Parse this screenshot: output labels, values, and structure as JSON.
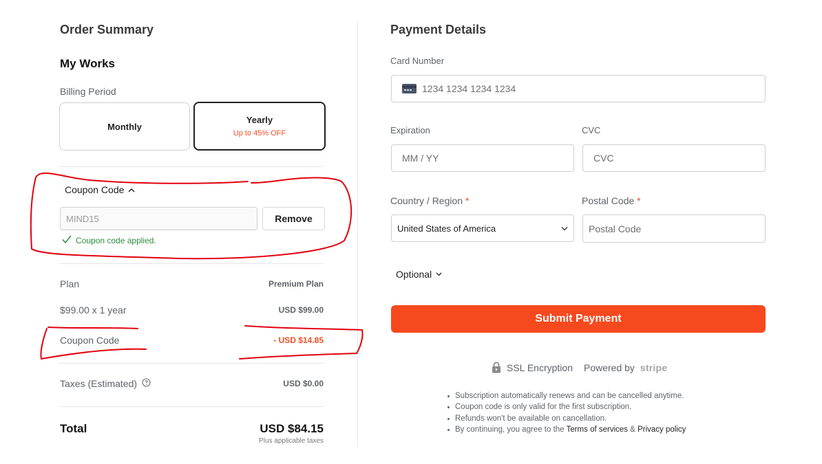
{
  "order_summary": {
    "title": "Order Summary",
    "product_title": "My Works",
    "billing_period_label": "Billing Period",
    "billing_options": [
      {
        "label": "Monthly",
        "sub": "",
        "selected": false
      },
      {
        "label": "Yearly",
        "sub": "Up to 45% OFF",
        "selected": true
      }
    ],
    "coupon": {
      "toggle_label": "Coupon Code",
      "value": "MIND15",
      "remove_label": "Remove",
      "applied_message": "Coupon code applied."
    },
    "rows": {
      "plan_label": "Plan",
      "plan_value": "Premium Plan",
      "price_label": "$99.00 x 1 year",
      "price_value": "USD $99.00",
      "coupon_label": "Coupon Code",
      "coupon_value": "- USD $14.85",
      "taxes_label": "Taxes (Estimated)",
      "taxes_value": "USD $0.00"
    },
    "total": {
      "label": "Total",
      "value": "USD $84.15",
      "note": "Plus applicable taxes"
    }
  },
  "payment_details": {
    "title": "Payment Details",
    "card_number": {
      "label": "Card Number",
      "placeholder": "1234 1234 1234 1234"
    },
    "expiration": {
      "label": "Expiration",
      "placeholder": "MM / YY"
    },
    "cvc": {
      "label": "CVC",
      "placeholder": "CVC"
    },
    "country": {
      "label": "Country / Region",
      "required_mark": "*",
      "selected": "United States of America"
    },
    "postal": {
      "label": "Postal Code",
      "required_mark": "*",
      "placeholder": "Postal Code"
    },
    "optional_label": "Optional",
    "submit_label": "Submit Payment",
    "ssl_label": "SSL Encryption",
    "powered_by_label": "Powered by",
    "stripe_label": "stripe",
    "notes": [
      "Subscription automatically renews and can be cancelled anytime.",
      "Coupon code is only valid for the first subscription.",
      "Refunds won't be available on cancellation."
    ],
    "terms_note": {
      "prefix": "By continuing, you agree to the",
      "terms_link": "Terms of services",
      "amp": "&",
      "privacy_link": "Privacy policy"
    }
  },
  "colors": {
    "accent": "#f6491e",
    "success": "#2e8b3e",
    "annotation": "#e3000f"
  }
}
